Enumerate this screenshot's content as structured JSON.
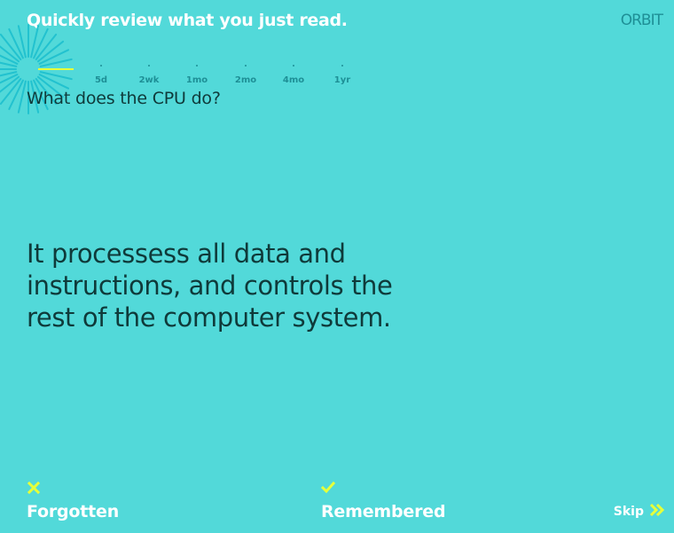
{
  "header": {
    "title": "Quickly review what you just read.",
    "logo_text": "ORBIT"
  },
  "timeline": {
    "intervals": [
      "5d",
      "2wk",
      "1mo",
      "2mo",
      "4mo",
      "1yr"
    ]
  },
  "card": {
    "question": "What does the CPU do?",
    "answer": "It processess all data and instructions, and controls the rest of the computer system."
  },
  "actions": {
    "forgotten_label": "Forgotten",
    "remembered_label": "Remembered",
    "skip_label": "Skip"
  },
  "icons": {
    "forgotten": "x-icon",
    "remembered": "check-icon",
    "skip": "double-chevron-right-icon"
  },
  "colors": {
    "background": "#52d9d9",
    "accent": "#e6ff3a",
    "text_dark": "#0f3a3a",
    "teal": "#1e8f96",
    "white": "#ffffff"
  }
}
